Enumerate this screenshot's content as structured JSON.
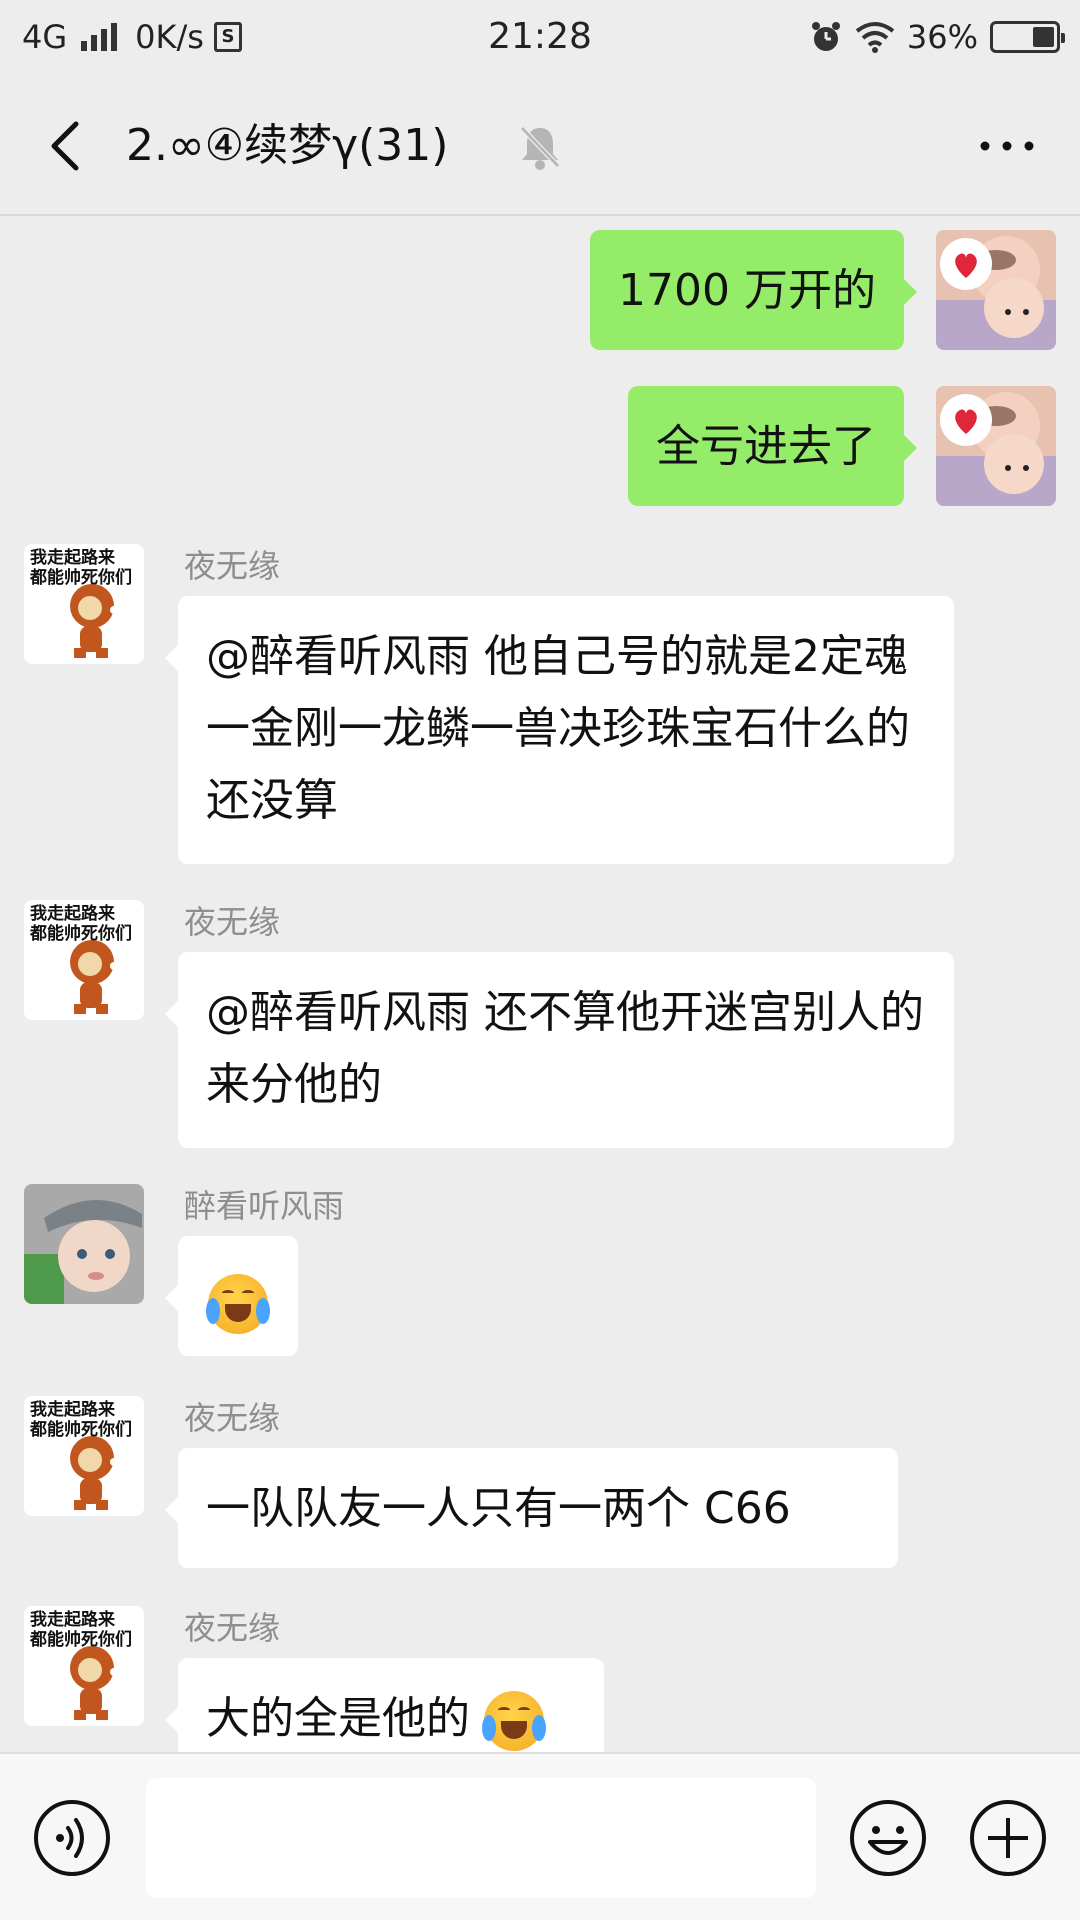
{
  "status_bar": {
    "network": "4G",
    "speed": "0K/s",
    "sim_icon": "S",
    "time": "21:28",
    "battery": "36%",
    "battery_level": 0.36,
    "icons": [
      "signal-icon",
      "sim-icon",
      "alarm-icon",
      "wifi-icon",
      "battery-icon"
    ]
  },
  "header": {
    "title": "2.∞④续梦γ(31)",
    "icons": [
      "back-icon",
      "mute-icon",
      "more-icon"
    ]
  },
  "messages": [
    {
      "side": "right",
      "text": "1700 万开的",
      "avatar": "babies-avatar"
    },
    {
      "side": "right",
      "text": "全亏进去了",
      "avatar": "babies-avatar"
    },
    {
      "side": "left",
      "sender": "夜无缘",
      "text": "@醉看听风雨  他自己号的就是2定魂一金刚一龙鳞一兽决珍珠宝石什么的还没算",
      "avatar": "meme-avatar"
    },
    {
      "side": "left",
      "sender": "夜无缘",
      "text": "@醉看听风雨  还不算他开迷宫别人的来分他的",
      "avatar": "meme-avatar"
    },
    {
      "side": "left",
      "sender": "醉看听风雨",
      "text": "",
      "emoji": "crying-laughing-emoji",
      "avatar": "kid-avatar"
    },
    {
      "side": "left",
      "sender": "夜无缘",
      "text": "一队队友一人只有一两个 C66",
      "avatar": "meme-avatar"
    },
    {
      "side": "left",
      "sender": "夜无缘",
      "text": "大的全是他的",
      "emoji": "crying-laughing-emoji",
      "avatar": "meme-avatar"
    }
  ],
  "meme_avatar_text": "我走起路来\n都能帅死你们",
  "input": {
    "value": "",
    "placeholder": ""
  },
  "colors": {
    "background": "#ededed",
    "sent_bubble": "#95ec69",
    "received_bubble": "#ffffff",
    "sender_name": "#8e8e8e"
  }
}
